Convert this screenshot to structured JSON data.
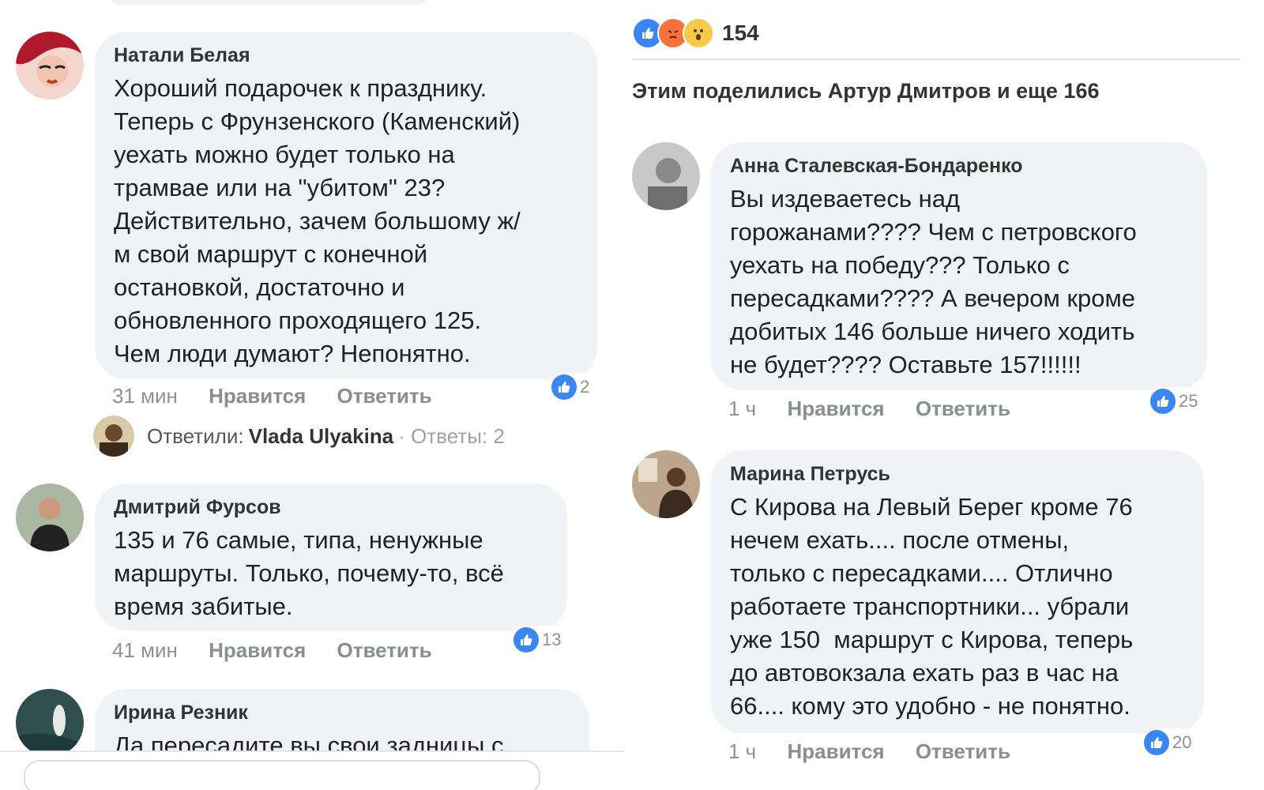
{
  "left": {
    "comments": [
      {
        "author": "Натали Белая",
        "text": "Хороший подарочек к празднику.\nТеперь с Фрунзенского (Каменский)\nуехать можно будет только на\nтрамвае или на \"убитом\" 23?\nДействительно, зачем большому ж/\nм свой маршрут с конечной\nостановкой, достаточно и\nобновленного проходящего 125.\nЧем люди думают? Непонятно.",
        "time": "31 мин",
        "like_action": "Нравится",
        "reply_action": "Ответить",
        "likes": "2"
      },
      {
        "author": "Дмитрий Фурсов",
        "text": "135 и 76 самые, типа, ненужные\nмаршруты. Только, почему-то, всё\nвремя забитые.",
        "time": "41 мин",
        "like_action": "Нравится",
        "reply_action": "Ответить",
        "likes": "13"
      },
      {
        "author": "Ирина Резник",
        "text": "Да пересадите вы свои задницы с"
      }
    ],
    "replies": {
      "prefix": "Ответили:",
      "who": "Vlada Ulyakina",
      "count": "· Ответы: 2"
    }
  },
  "right": {
    "reaction_count": "154",
    "shared_text": "Этим поделились Артур Дмитров и еще 166",
    "comments": [
      {
        "author": "Анна Сталевская-Бондаренко",
        "text": "Вы издеваетесь над\nгорожанами???? Чем с петровского\nуехать на победу??? Только с\nпересадками???? А вечером кроме\nдобитых 146 больше ничего ходить\nне будет???? Оставьте 157!!!!!!",
        "time": "1 ч",
        "like_action": "Нравится",
        "reply_action": "Ответить",
        "likes": "25"
      },
      {
        "author": "Марина Петрусь",
        "text": "С Кирова на Левый Берег кроме 76\nнечем ехать.... после отмены,\nтолько с пересадками.... Отлично\nработаете транспортники... убрали\nуже 150  маршрут с Кирова, теперь\nдо автовокзала ехать раз в час на\n66.... кому это удобно - не понятно.",
        "time": "1 ч",
        "like_action": "Нравится",
        "reply_action": "Ответить",
        "likes": "20"
      }
    ]
  },
  "colors": {
    "bubble": "#f0f2f5",
    "like_blue": "#3b86f5",
    "meta_gray": "#909090"
  },
  "icons": {
    "like": "thumbs-up-icon",
    "angry": "angry-face-icon",
    "wow": "wow-face-icon"
  }
}
